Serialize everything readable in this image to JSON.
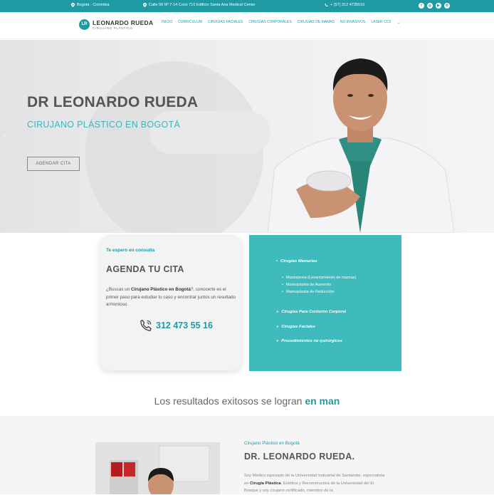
{
  "topbar": {
    "location": "Bogotá - Colombia",
    "address": "Calle 99 Nº 7-14 Cons 710 Edificio Santa Ana Medical Center",
    "phone": "+ (57) 312 4735516",
    "socials": [
      "facebook-icon",
      "instagram-icon",
      "youtube-icon",
      "whatsapp-icon"
    ]
  },
  "header": {
    "logo_mark": "LR",
    "logo_name": "LEONARDO RUEDA",
    "logo_sub": "CIRUJANO PLÁSTICO",
    "nav": [
      "INICIO",
      "CURRICULUM",
      "CIRUGÍAS FACIALES",
      "CIRUGÍAS CORPORALES",
      "CIRUGÍAS DE MAMAS",
      "NO INVASIVOS",
      "LÁSER CO2"
    ]
  },
  "hero": {
    "title": "DR LEONARDO RUEDA",
    "subtitle": "CIRUJANO PLÁSTICO EN BOGOTÁ",
    "cta": "AGENDAR CITA",
    "prev_arrow": "‹"
  },
  "appointment": {
    "kicker": "Te espero en consulta",
    "title": "AGENDA TU CITA",
    "text_before": "¿Buscas un ",
    "text_bold": "Cirujano Plástico en Bogotá",
    "text_after": "?, conocerte es el primer paso para estudiar tu caso y encontrar juntos un resultado armonioso.",
    "phone": "312 473 55 16"
  },
  "services": {
    "heading_mamarias": "Cirugías Mamarias",
    "mamarias_items": [
      "Mastopexia (Levantamiento de mamas)",
      "Mamoplastia de Aumento",
      "Mamoplastia de Reducción"
    ],
    "heading_corporal": "Cirugías Para Contorno Corporal",
    "heading_faciales": "Cirugías Faciales",
    "heading_no_quirurgicos": "Procedimientos no quirúrgicos"
  },
  "results": {
    "text": "Los resultados exitosos se logran ",
    "highlight": "en man"
  },
  "bio": {
    "kicker": "Cirujano Plástico en Bogotá",
    "title": "DR. LEONARDO RUEDA.",
    "text_1": "Soy Médico egresado de la Universidad Industrial de Santander, especialista en ",
    "text_bold": "Cirugía Plástica",
    "text_2": ", Estética y Reconstructiva de la Universidad del El Bosque y soy cirujano certificado, miembro de la"
  },
  "colors": {
    "accent": "#1f9aa3",
    "teal_box": "#3fbabd"
  }
}
